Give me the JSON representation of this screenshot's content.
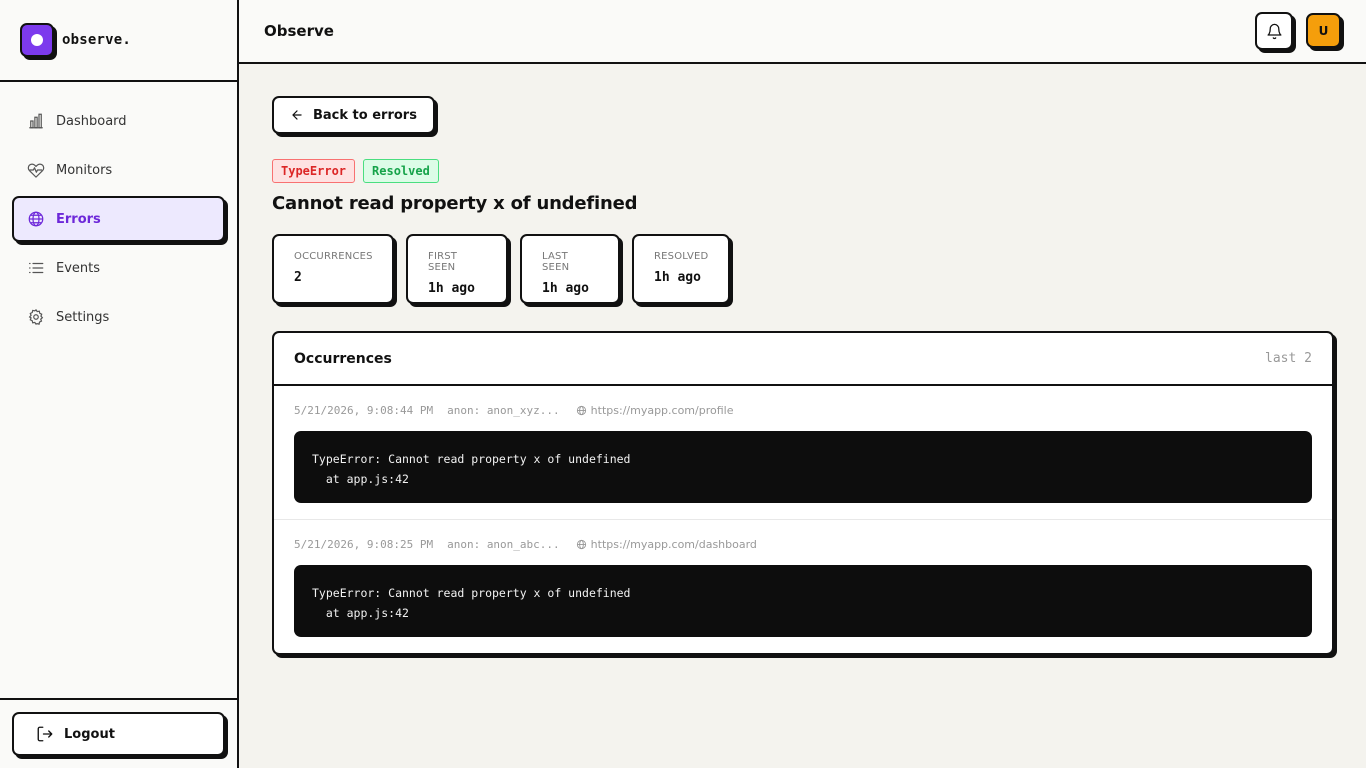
{
  "brand": {
    "name": "observe."
  },
  "nav": [
    {
      "label": "Dashboard",
      "icon": "bar-chart-icon"
    },
    {
      "label": "Monitors",
      "icon": "heart-pulse-icon"
    },
    {
      "label": "Errors",
      "icon": "globe-icon",
      "active": true
    },
    {
      "label": "Events",
      "icon": "list-icon"
    },
    {
      "label": "Settings",
      "icon": "gear-icon"
    }
  ],
  "logout_label": "Logout",
  "header": {
    "title": "Observe",
    "avatar_initial": "U"
  },
  "back_label": "Back to errors",
  "error": {
    "type": "TypeError",
    "status": "Resolved",
    "title": "Cannot read property x of undefined"
  },
  "stats": [
    {
      "label": "Occurrences",
      "value": "2"
    },
    {
      "label": "First Seen",
      "value": "1h ago"
    },
    {
      "label": "Last Seen",
      "value": "1h ago"
    },
    {
      "label": "Resolved",
      "value": "1h ago"
    }
  ],
  "occurrences": {
    "title": "Occurrences",
    "count_label": "last 2",
    "items": [
      {
        "timestamp": "5/21/2026, 9:08:44 PM",
        "user": "anon: anon_xyz...",
        "url": "https://myapp.com/profile",
        "stack": "TypeError: Cannot read property x of undefined\n  at app.js:42"
      },
      {
        "timestamp": "5/21/2026, 9:08:25 PM",
        "user": "anon: anon_abc...",
        "url": "https://myapp.com/dashboard",
        "stack": "TypeError: Cannot read property x of undefined\n  at app.js:42"
      }
    ]
  },
  "colors": {
    "accent": "#7c3aed",
    "active_bg": "#ede9fe",
    "avatar": "#f59e0b",
    "error": "#dc2626",
    "success": "#16a34a"
  }
}
